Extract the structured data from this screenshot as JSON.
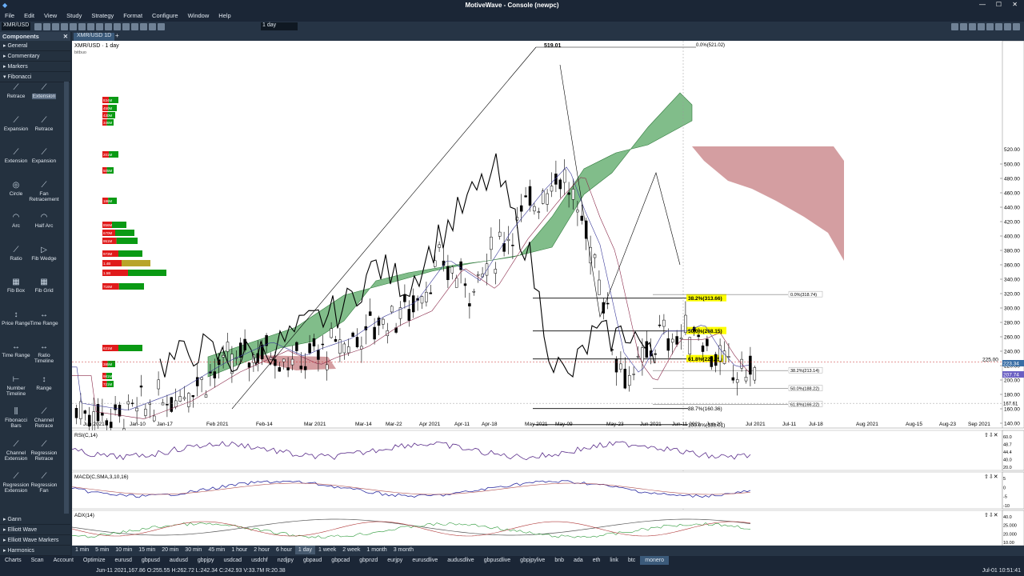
{
  "window": {
    "title": "MotiveWave - Console (newpc)"
  },
  "menu": [
    "File",
    "Edit",
    "View",
    "Study",
    "Strategy",
    "Format",
    "Configure",
    "Window",
    "Help"
  ],
  "toolbar": {
    "symbol": "XMR/USD",
    "interval": "1 day"
  },
  "components": {
    "header": "Components",
    "categories": [
      "General",
      "Commentary",
      "Markers",
      "Fibonacci"
    ],
    "tools": [
      "Retrace",
      "Extension",
      "Expansion",
      "Retrace",
      "Extension",
      "Expansion",
      "Circle",
      "Fan Retracement",
      "Arc",
      "Half Arc",
      "Ratio",
      "Fib Wedge",
      "Fib Box",
      "Fib Grid",
      "Price Range",
      "Time Range",
      "Time Range",
      "Ratio Timeline",
      "Number Timeline",
      "Range",
      "Fibonacci Bars",
      "Channel Retrace",
      "Channel Extension",
      "Regression Retrace",
      "Regression Extension",
      "Regression Fan"
    ],
    "bottom_categories": [
      "Gann",
      "Elliott Wave",
      "Elliott Wave Markers",
      "Harmonics"
    ]
  },
  "chart": {
    "tab": "XMR/USD 1D",
    "label": "XMR/USD · 1 day",
    "sublabel": "bitbuo",
    "price_axis": [
      "500.00",
      "480.00",
      "460.00",
      "440.00",
      "420.00",
      "400.00",
      "380.00",
      "360.00",
      "340.00",
      "320.00",
      "300.00",
      "280.00",
      "260.00",
      "240.00",
      "220.00",
      "200.00",
      "180.00",
      "160.00",
      "140.00"
    ],
    "price_top": "520.00",
    "price_225": "225.00",
    "price_last": "223.34",
    "price_alt": "207.74",
    "price_cross": "167.61",
    "date_axis": [
      "Jun 2021",
      "Jan-10",
      "Jan-17",
      "Feb 2021",
      "Feb-14",
      "Mar 2021",
      "Mar-14",
      "Mar-22",
      "Apr 2021",
      "Apr-11",
      "Apr-18",
      "May 2021",
      "May-09",
      "May-23",
      "Jun 2021",
      "Jun-11 2021",
      "Jun-20",
      "Jul 2021",
      "Jul-11",
      "Jul-18",
      "Aug 2021",
      "Aug-15",
      "Aug-23",
      "Sep 2021"
    ],
    "high_label": "519.01",
    "fib_left": [
      {
        "t": "38.2%(313.66)",
        "hl": true
      },
      {
        "t": "50.0%(268.15)",
        "hl": true
      },
      {
        "t": "61.8%(229.25)",
        "hl": true
      },
      {
        "t": "88.7%(160.36)",
        "hl": false
      },
      {
        "t": "100.0%(138.01)",
        "hl": false
      }
    ],
    "fib_right": [
      "0.0%(318.74)",
      "38.2%(213.14)",
      "50.0%(188.22)",
      "61.8%(166.22)",
      "88.7%(125.20)"
    ],
    "fib_top": "0.0%(521.02)",
    "vp_labels": [
      "834M",
      "450M",
      "430M",
      "346M",
      "201M",
      "505M",
      "186M",
      "856M",
      "670M",
      "951M",
      "973M",
      "1.4B",
      "1.5B",
      "716M",
      "621M",
      "385M",
      "981M",
      "721M"
    ],
    "cursor_label": "Jun-11 2021"
  },
  "rsi": {
    "label": "RSI(C,14)",
    "axis": [
      "60.0",
      "48.7",
      "44.4",
      "40.0",
      "20.0"
    ]
  },
  "macd": {
    "label": "MACD(C,SMA,3,10,16)",
    "axis": [
      "5",
      "0",
      "-5",
      "-10"
    ]
  },
  "adx": {
    "label": "ADX(14)",
    "axis": [
      "40.0",
      "25.000",
      "20.000",
      "10.00"
    ]
  },
  "timeframes": [
    "1 min",
    "5 min",
    "10 min",
    "15 min",
    "20 min",
    "30 min",
    "45 min",
    "1 hour",
    "2 hour",
    "6 hour",
    "1 day",
    "1 week",
    "2 week",
    "1 month",
    "3 month"
  ],
  "timeframe_active": "1 day",
  "symbols": [
    "Charts",
    "Scan",
    "Account",
    "Optimize",
    "eurusd",
    "gbpusd",
    "audusd",
    "gbpjpy",
    "usdcad",
    "usdchf",
    "nzdjpy",
    "gbpaud",
    "gbpcad",
    "gbpnzd",
    "eurjpy",
    "eurusdlive",
    "audusdlive",
    "gbpusdlive",
    "gbpjpylive",
    "bnb",
    "ada",
    "eth",
    "link",
    "btc",
    "monero"
  ],
  "symbol_active": "monero",
  "status": {
    "ohlc": "Jun-11 2021,167.86 O:255.55 H:262.72 L:242.34 C:242.93 V:33.7M R:20.38",
    "right": "Jul-01 10:51:41"
  },
  "colors": {
    "cloud_green": "#3d9a4b",
    "cloud_red": "#c9868a",
    "fib_yellow": "#ffff00",
    "panel_bg": "#24313f"
  }
}
